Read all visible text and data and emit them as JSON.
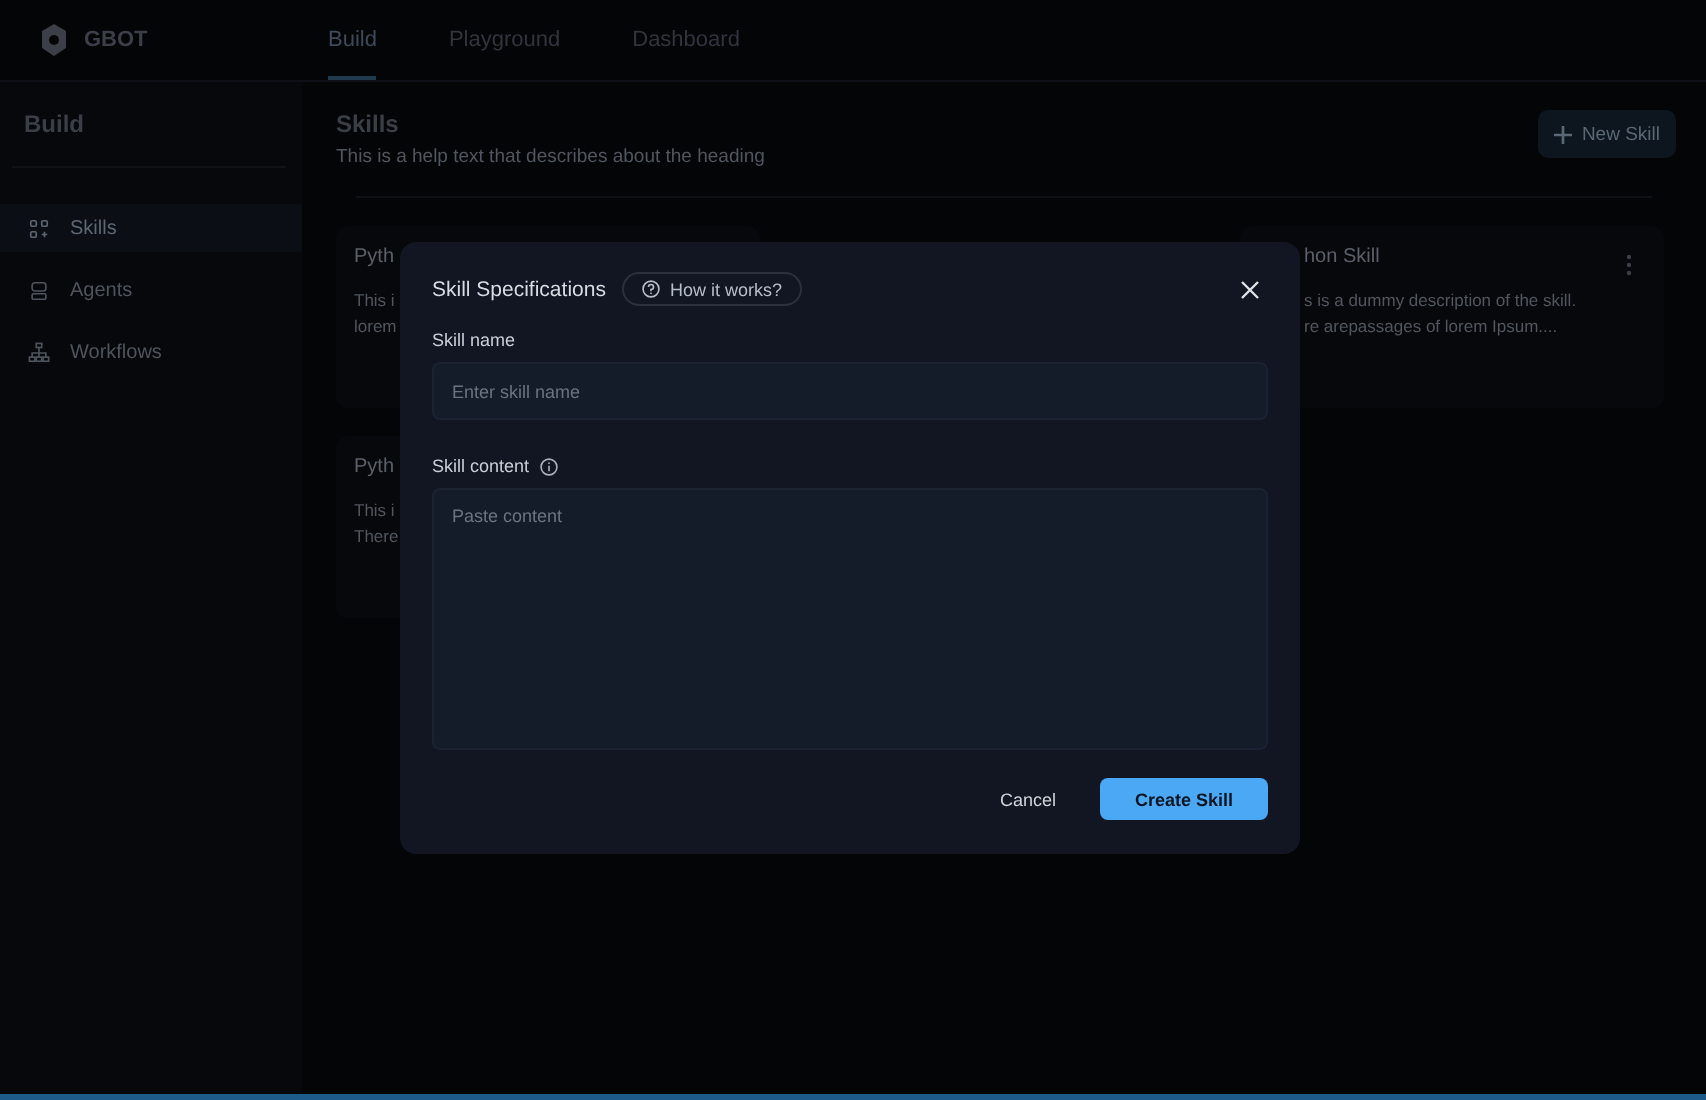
{
  "app": {
    "logo_text": "GBOT"
  },
  "nav_tabs": [
    {
      "label": "Build",
      "selected": true
    },
    {
      "label": "Playground",
      "selected": false
    },
    {
      "label": "Dashboard",
      "selected": false
    }
  ],
  "sidebar": {
    "title": "Build",
    "items": [
      {
        "label": "Skills",
        "selected": true
      },
      {
        "label": "Agents",
        "selected": false
      },
      {
        "label": "Workflows",
        "selected": false
      }
    ]
  },
  "page": {
    "title": "Skills",
    "help_text": "This is a help text that describes about the heading",
    "new_button": "New Skill"
  },
  "card_rows": [
    [
      {
        "kind": "left",
        "title": "Pyth",
        "lines": [
          "This i",
          "lorem"
        ]
      },
      {
        "kind": "hidden"
      },
      {
        "kind": "right",
        "title": "hon Skill",
        "lines": [
          "s is a dummy description of the skill.",
          "re arepassages of lorem Ipsum...."
        ]
      }
    ],
    [
      {
        "kind": "left",
        "title": "Pyth",
        "lines": [
          "This i",
          "There"
        ]
      }
    ]
  ],
  "modal": {
    "title": "Skill Specifications",
    "help_link": "How it works?",
    "fields": [
      {
        "kind": "input",
        "label": "Skill name",
        "placeholder": "Enter skill name",
        "info": false
      },
      {
        "kind": "textarea",
        "label": "Skill content",
        "placeholder": "Paste content",
        "info": true
      }
    ],
    "cancel": "Cancel",
    "submit": "Create Skill"
  }
}
